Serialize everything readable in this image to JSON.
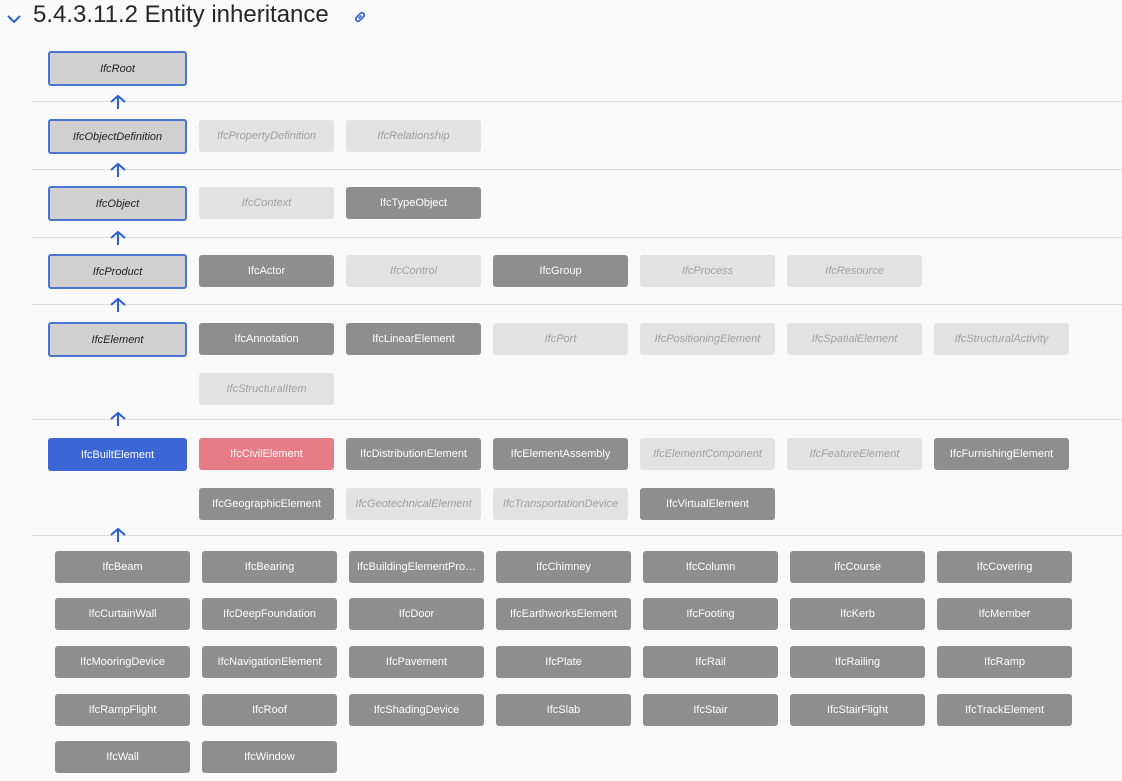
{
  "section": {
    "title": "5.4.3.11.2 Entity inheritance"
  },
  "icons": {
    "collapse": "chevron-down-icon",
    "link": "link-icon"
  },
  "colors": {
    "accent": "#3c66d6",
    "ancestor_fill": "#d0d0d0",
    "subtype_fill": "#8e8e8e",
    "abstract_fill": "#e2e2e2",
    "sibling_highlight": "#e77c86"
  },
  "levels": [
    {
      "ancestor": "IfcRoot",
      "siblings": []
    },
    {
      "ancestor": "IfcObjectDefinition",
      "siblings": [
        {
          "name": "IfcPropertyDefinition",
          "abstract": true
        },
        {
          "name": "IfcRelationship",
          "abstract": true
        }
      ]
    },
    {
      "ancestor": "IfcObject",
      "siblings": [
        {
          "name": "IfcContext",
          "abstract": true
        },
        {
          "name": "IfcTypeObject",
          "abstract": false
        }
      ]
    },
    {
      "ancestor": "IfcProduct",
      "siblings": [
        {
          "name": "IfcActor",
          "abstract": false
        },
        {
          "name": "IfcControl",
          "abstract": true
        },
        {
          "name": "IfcGroup",
          "abstract": false
        },
        {
          "name": "IfcProcess",
          "abstract": true
        },
        {
          "name": "IfcResource",
          "abstract": true
        }
      ]
    },
    {
      "ancestor": "IfcElement",
      "siblings": [
        {
          "name": "IfcAnnotation",
          "abstract": false
        },
        {
          "name": "IfcLinearElement",
          "abstract": false
        },
        {
          "name": "IfcPort",
          "abstract": true
        },
        {
          "name": "IfcPositioningElement",
          "abstract": true
        },
        {
          "name": "IfcSpatialElement",
          "abstract": true
        },
        {
          "name": "IfcStructuralActivity",
          "abstract": true
        },
        {
          "name": "IfcStructuralItem",
          "abstract": true
        }
      ]
    }
  ],
  "current": {
    "name": "IfcBuiltElement",
    "siblings": [
      {
        "name": "IfcCivilElement",
        "abstract": false,
        "highlight": true
      },
      {
        "name": "IfcDistributionElement",
        "abstract": false
      },
      {
        "name": "IfcElementAssembly",
        "abstract": false
      },
      {
        "name": "IfcElementComponent",
        "abstract": true
      },
      {
        "name": "IfcFeatureElement",
        "abstract": true
      },
      {
        "name": "IfcFurnishingElement",
        "abstract": false
      },
      {
        "name": "IfcGeographicElement",
        "abstract": false
      },
      {
        "name": "IfcGeotechnicalElement",
        "abstract": true
      },
      {
        "name": "IfcTransportationDevice",
        "abstract": true
      },
      {
        "name": "IfcVirtualElement",
        "abstract": false
      }
    ]
  },
  "subtypes": [
    "IfcBeam",
    "IfcBearing",
    "IfcBuildingElementPro…",
    "IfcChimney",
    "IfcColumn",
    "IfcCourse",
    "IfcCovering",
    "IfcCurtainWall",
    "IfcDeepFoundation",
    "IfcDoor",
    "IfcEarthworksElement",
    "IfcFooting",
    "IfcKerb",
    "IfcMember",
    "IfcMooringDevice",
    "IfcNavigationElement",
    "IfcPavement",
    "IfcPlate",
    "IfcRail",
    "IfcRailing",
    "IfcRamp",
    "IfcRampFlight",
    "IfcRoof",
    "IfcShadingDevice",
    "IfcSlab",
    "IfcStair",
    "IfcStairFlight",
    "IfcTrackElement",
    "IfcWall",
    "IfcWindow"
  ]
}
